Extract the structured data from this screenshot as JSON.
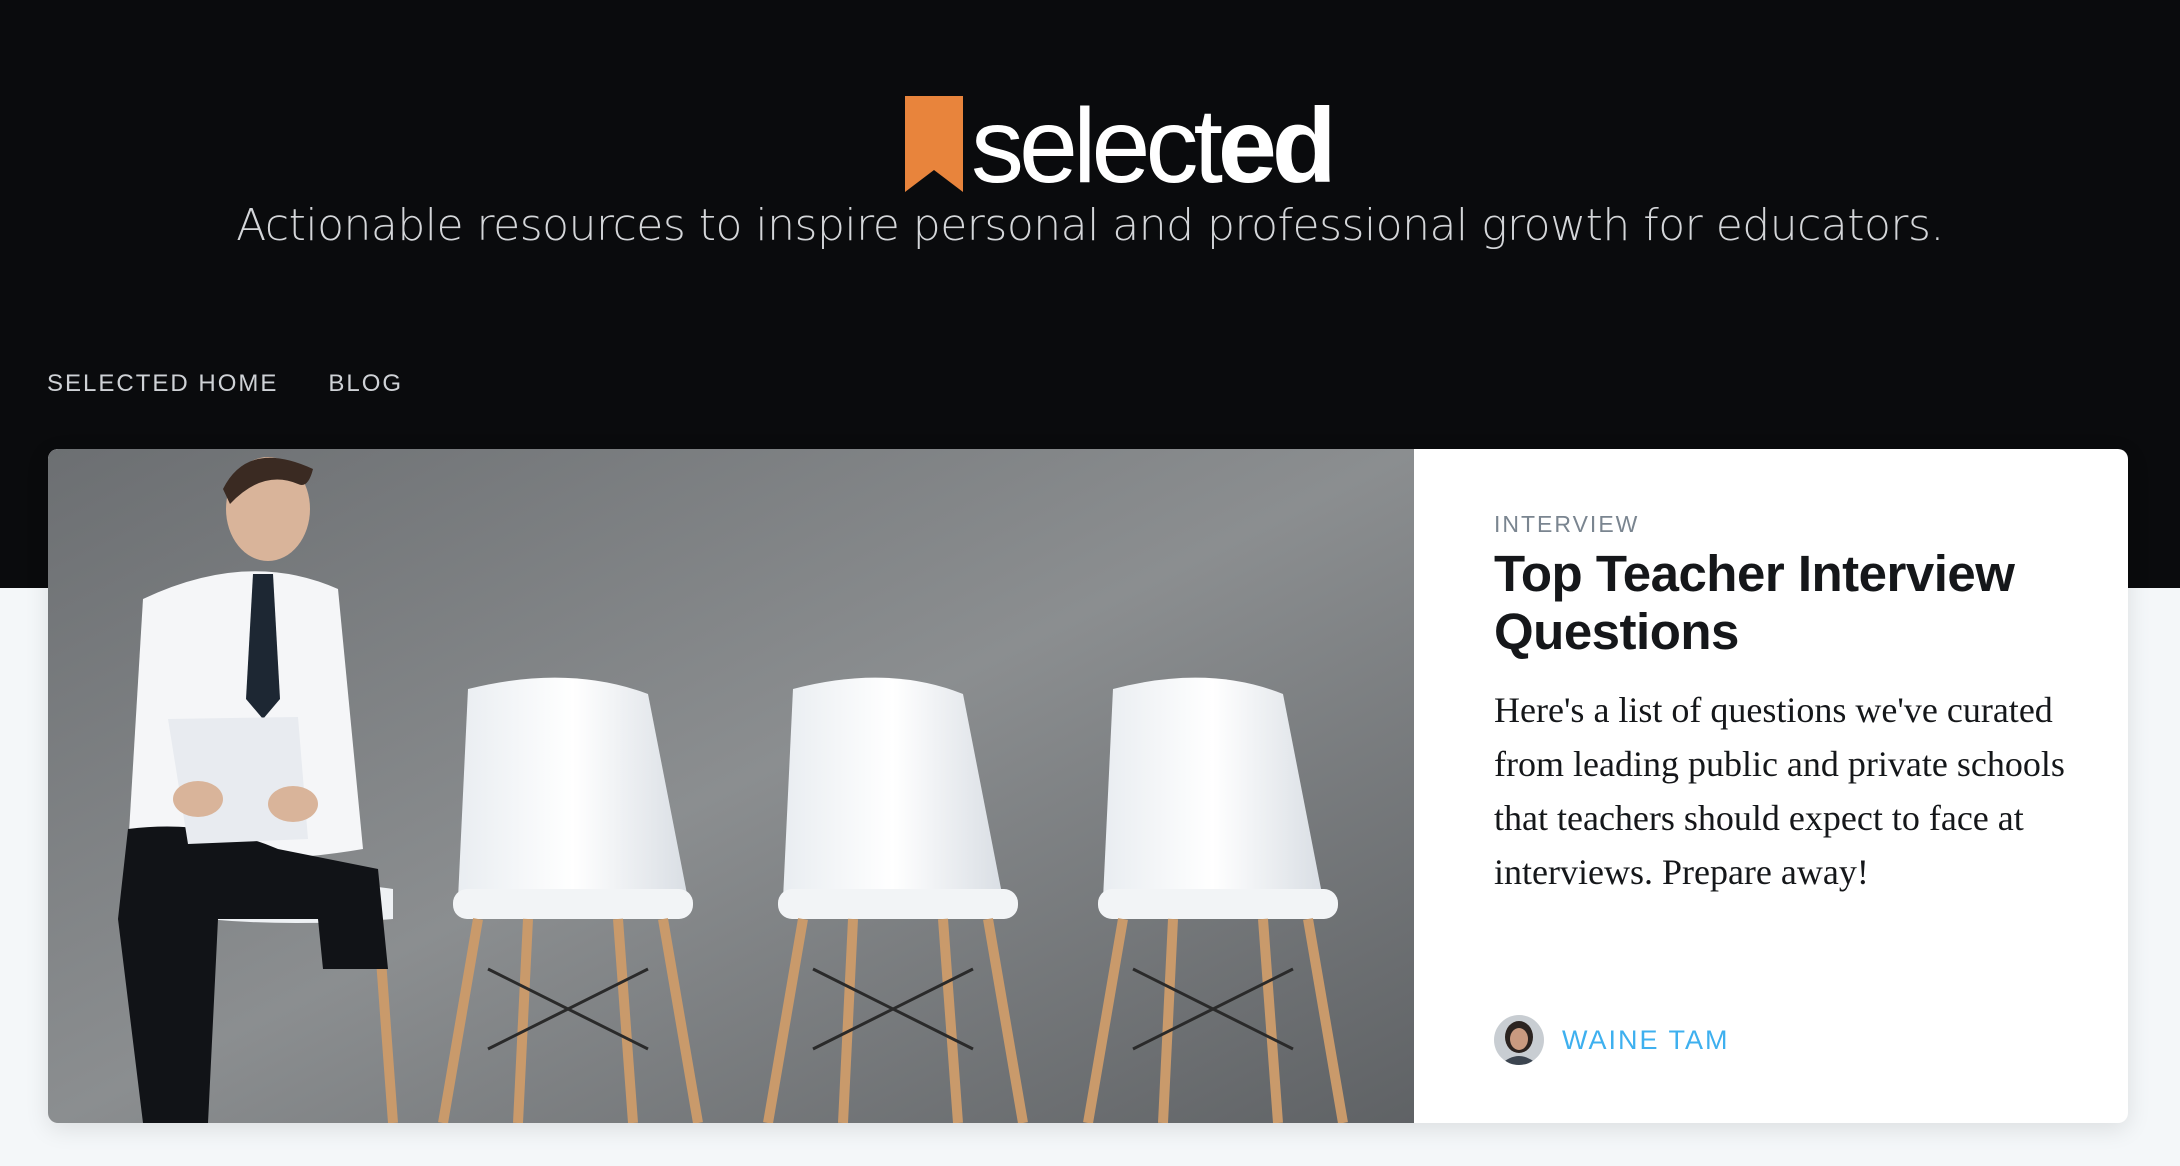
{
  "site": {
    "logo": {
      "text_light": "selec",
      "text_bold": "ed",
      "text_t": "t"
    },
    "tagline": "Actionable resources to inspire personal and professional growth for educators."
  },
  "nav": {
    "items": [
      {
        "label": "SELECTED HOME"
      },
      {
        "label": "BLOG"
      }
    ]
  },
  "featured_post": {
    "category": "INTERVIEW",
    "title": "Top Teacher Interview Questions",
    "excerpt": "Here's a list of questions we've curated from leading public and private schools that teachers should expect to face at interviews. Prepare away!",
    "author": {
      "name": "WAINE TAM"
    },
    "image_icon": "job-interview-waiting-chairs-photo"
  },
  "colors": {
    "header_bg": "#0a0b0d",
    "logo_accent": "#e8843c",
    "author_link": "#3eb0ef",
    "page_bg": "#f4f7f9"
  }
}
